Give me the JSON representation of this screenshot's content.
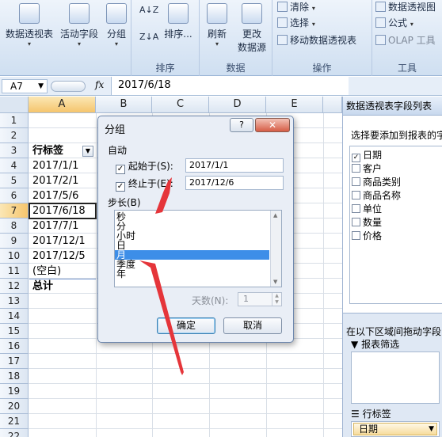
{
  "ribbon": {
    "buttons_left": [
      {
        "label": "数据透视表",
        "icon": "pivot-table-icon"
      },
      {
        "label": "活动字段",
        "icon": "active-field-icon"
      },
      {
        "label": "分组",
        "icon": "group-icon"
      }
    ],
    "sort_group": {
      "title": "排序",
      "sort_label": "排序..."
    },
    "data_group": {
      "title": "数据",
      "refresh_label": "刷新",
      "change_source_line1": "更改",
      "change_source_line2": "数据源"
    },
    "actions_group": {
      "title": "操作",
      "clear_label": "清除",
      "select_label": "选择",
      "move_label": "移动数据透视表"
    },
    "tools_group": {
      "title": "工具",
      "pivotchart_label": "数据透视图",
      "formula_label": "公式",
      "olap_label": "OLAP 工具"
    }
  },
  "formula_bar": {
    "name_box": "A7",
    "fx": "fx",
    "value": "2017/6/18"
  },
  "columns": [
    "A",
    "B",
    "C",
    "D",
    "E"
  ],
  "rows": [
    "1",
    "2",
    "3",
    "4",
    "5",
    "6",
    "7",
    "8",
    "9",
    "10",
    "11",
    "12",
    "13",
    "14",
    "15",
    "16",
    "17",
    "18",
    "19",
    "20",
    "21",
    "22"
  ],
  "cells": {
    "header": "行标签",
    "items": [
      "2017/1/1",
      "2017/2/1",
      "2017/5/6",
      "2017/6/18",
      "2017/7/1",
      "2017/12/1",
      "2017/12/5",
      "(空白)"
    ],
    "total": "总计"
  },
  "dialog": {
    "title": "分组",
    "help": "?",
    "auto_label": "自动",
    "start_label": "起始于(S):",
    "start_value": "2017/1/1",
    "end_label": "终止于(E):",
    "end_value": "2017/12/6",
    "step_label": "步长(B)",
    "step_options": [
      "秒",
      "分",
      "小时",
      "日",
      "月",
      "季度",
      "年"
    ],
    "selected_option": "月",
    "days_label": "天数(N):",
    "days_value": "1",
    "ok_label": "确定",
    "cancel_label": "取消"
  },
  "field_pane": {
    "title": "数据透视表字段列表",
    "choose_label": "选择要添加到报表的字",
    "fields": [
      {
        "name": "日期",
        "checked": true
      },
      {
        "name": "客户",
        "checked": false
      },
      {
        "name": "商品类别",
        "checked": false
      },
      {
        "name": "商品名称",
        "checked": false
      },
      {
        "name": "单位",
        "checked": false
      },
      {
        "name": "数量",
        "checked": false
      },
      {
        "name": "价格",
        "checked": false
      }
    ],
    "drag_label": "在以下区域间拖动字段",
    "report_filter_label": "报表筛选",
    "row_labels_label": "行标签",
    "row_field": "日期"
  },
  "colors": {
    "arrow": "#e5353a",
    "selection": "#3d8ee8",
    "ribbon": "#dbe7f5"
  }
}
